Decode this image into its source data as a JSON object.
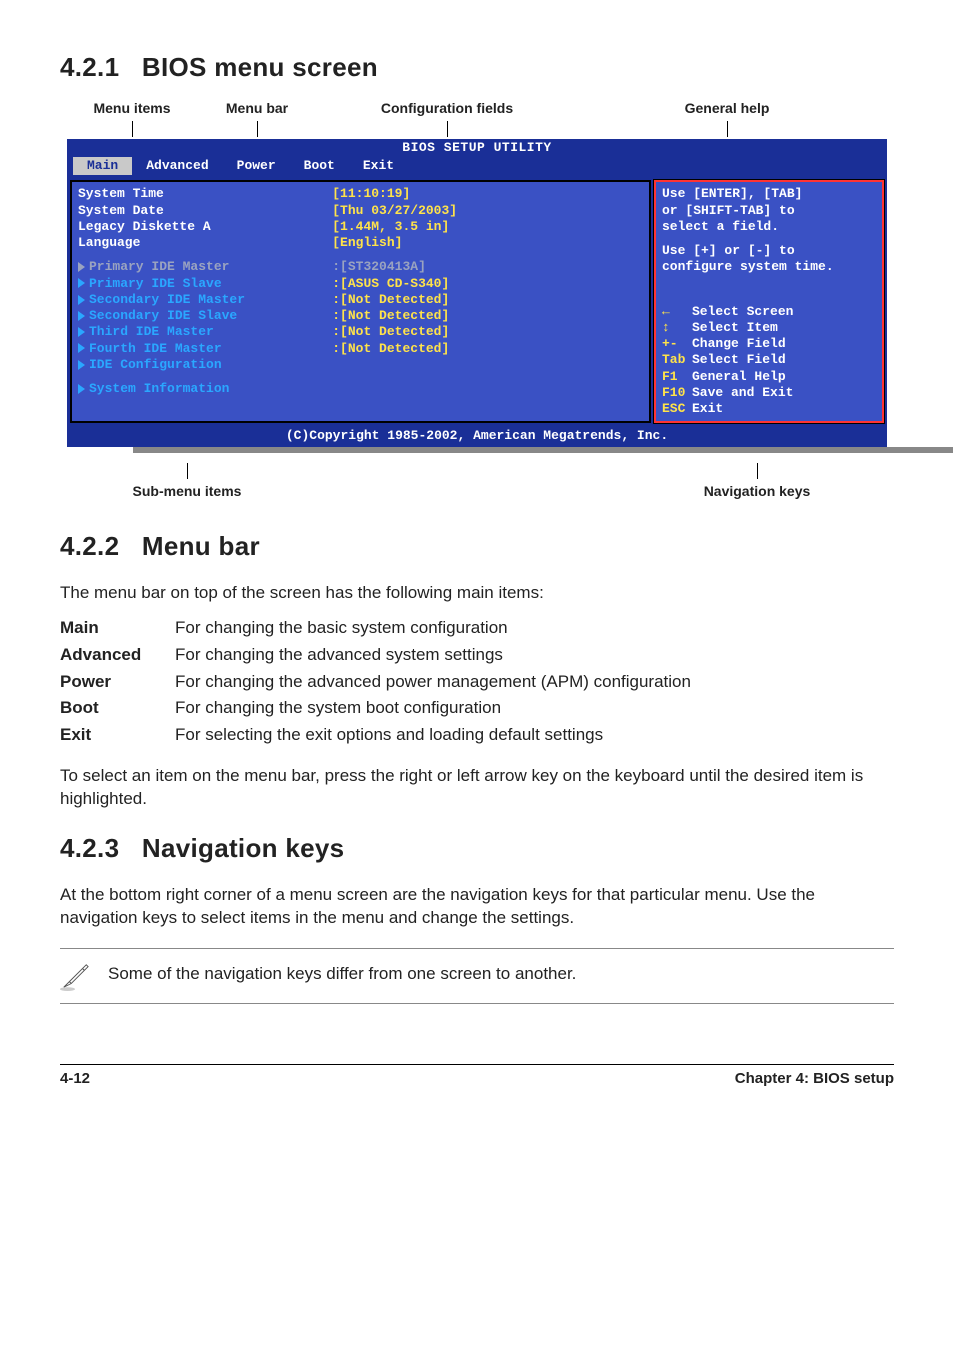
{
  "sections": {
    "s1": {
      "num": "4.2.1",
      "title": "BIOS menu screen"
    },
    "s2": {
      "num": "4.2.2",
      "title": "Menu bar"
    },
    "s3": {
      "num": "4.2.3",
      "title": "Navigation keys"
    }
  },
  "annotation_top": {
    "menu_items": "Menu items",
    "menu_bar": "Menu bar",
    "config_fields": "Configuration fields",
    "general_help": "General help"
  },
  "annotation_bottom": {
    "submenu": "Sub-menu items",
    "navkeys": "Navigation keys"
  },
  "bios": {
    "title": "BIOS SETUP UTILITY",
    "tabs": [
      "Main",
      "Advanced",
      "Power",
      "Boot",
      "Exit"
    ],
    "left_labels": {
      "system_time": "System Time",
      "system_date": "System Date",
      "legacy": "Legacy Diskette A",
      "language": "Language",
      "sub1": "Primary IDE Master",
      "sub2": "Primary IDE Slave",
      "sub3": "Secondary IDE Master",
      "sub4": "Secondary IDE Slave",
      "sub5": "Third IDE Master",
      "sub6": "Fourth IDE Master",
      "sub7": "IDE Configuration",
      "sysinfo": "System Information"
    },
    "left_values": {
      "system_time": "[11:10:19]",
      "system_date": "[Thu 03/27/2003]",
      "legacy": "[1.44M, 3.5 in]",
      "language": "[English]",
      "sub1": ":[ST320413A]",
      "sub2": ":[ASUS CD-S340]",
      "sub3": ":[Not Detected]",
      "sub4": ":[Not Detected]",
      "sub5": ":[Not Detected]",
      "sub6": ":[Not Detected]"
    },
    "help_top1": "Use [ENTER], [TAB]",
    "help_top2": "or [SHIFT-TAB] to",
    "help_top3": "select a field.",
    "help_mid1": "Use [+] or [-] to",
    "help_mid2": "configure system time.",
    "keys": {
      "k1": "Select Screen",
      "k2": "Select Item",
      "k3": "Change Field",
      "k4": "Select Field",
      "k5": "General Help",
      "k6": "Save and Exit",
      "k7": "Exit",
      "s3": "+-",
      "s4": "Tab",
      "s5": "F1",
      "s6": "F10",
      "s7": "ESC"
    },
    "footer": "(C)Copyright 1985-2002, American Megatrends, Inc."
  },
  "text": {
    "menubar_intro": "The menu bar on top of the screen has the following main items:",
    "items": {
      "main": {
        "term": "Main",
        "desc": "For changing the basic system configuration"
      },
      "advanced": {
        "term": "Advanced",
        "desc": "For changing the advanced system settings"
      },
      "power": {
        "term": "Power",
        "desc": "For changing the advanced power management (APM) configuration"
      },
      "boot": {
        "term": "Boot",
        "desc": "For changing the system boot configuration"
      },
      "exit": {
        "term": "Exit",
        "desc": "For selecting the exit options and loading default settings"
      }
    },
    "menubar_outro": "To select an item on the menu bar, press the right or left arrow key on the keyboard until the desired item is highlighted.",
    "navkeys_para": "At the bottom right corner of a menu screen are the navigation keys for that particular menu. Use the navigation keys to select items in the menu and change the settings.",
    "note": "Some of the navigation keys differ from one screen to another."
  },
  "footer": {
    "left": "4-12",
    "right": "Chapter 4: BIOS setup"
  }
}
